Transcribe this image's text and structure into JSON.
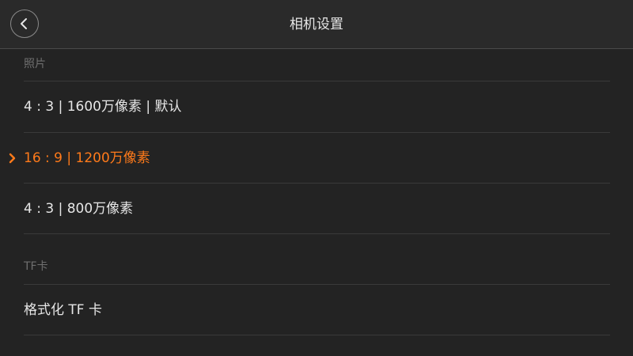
{
  "header": {
    "title": "相机设置",
    "back_icon": "chevron-left-icon"
  },
  "sections": [
    {
      "label": "照片",
      "options": [
        {
          "label": "4 : 3 | 1600万像素 | 默认",
          "selected": false
        },
        {
          "label": "16 : 9 | 1200万像素",
          "selected": true
        },
        {
          "label": "4 : 3 | 800万像素",
          "selected": false
        }
      ]
    },
    {
      "label": "TF卡",
      "options": [
        {
          "label": "格式化 TF 卡",
          "selected": false
        }
      ]
    }
  ],
  "colors": {
    "background": "#232323",
    "header": "#2a2a2a",
    "accent": "#ff7a1a",
    "text": "#e6e6e6",
    "section_label": "#6f6f6f",
    "divider": "#3a3a3a"
  },
  "selected_indicator_icon": "chevron-right-icon"
}
